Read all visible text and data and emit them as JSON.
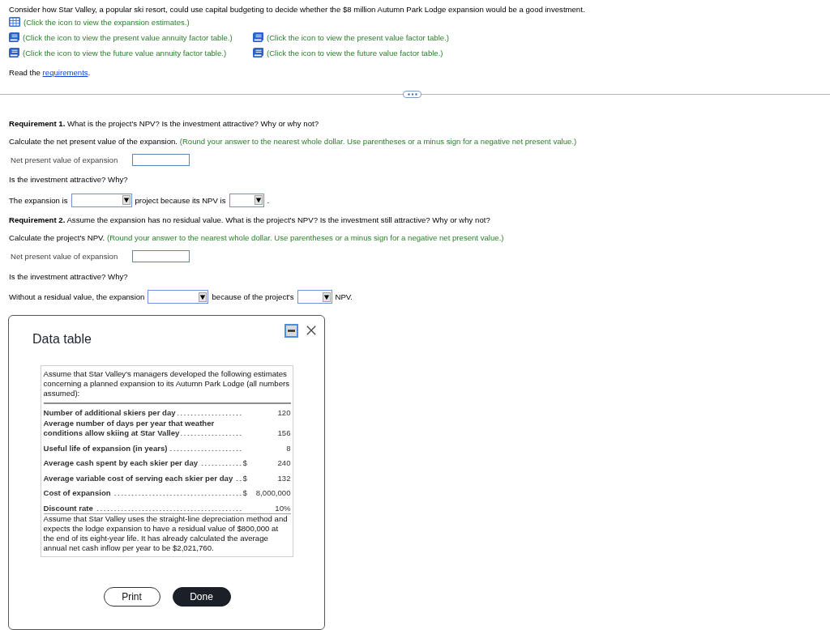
{
  "intro": "Consider how Star Valley, a popular ski resort, could use capital budgeting to decide whether the $8 million Autumn Park Lodge expansion would be a good investment.",
  "resources": [
    {
      "kind": "table",
      "text": "(Click the icon to view the expansion estimates.)"
    },
    {
      "kind": "book",
      "text": "(Click the icon to view the present value annuity factor table.)"
    },
    {
      "kind": "book",
      "text": "(Click the icon to view the present value factor table.)"
    },
    {
      "kind": "book",
      "text": "(Click the icon to view the future value annuity factor table.)"
    },
    {
      "kind": "book",
      "text": "(Click the icon to view the future value factor table.)"
    }
  ],
  "read_line": {
    "before": "Read the",
    "link": "requirements",
    "after": "."
  },
  "requirements": [
    {
      "question": "**Requirement 1.** What is the project's NPV? Is the investment attractive? Why or why not?",
      "instruction": "Calculate the net present value of the expansion.",
      "hint": "(Round your answer to the nearest whole dollar. Use parentheses or a minus sign for a negative net present value.)",
      "field_label": "Net present value of expansion",
      "followup": "Is the investment attractive? Why?",
      "sentence": [
        {
          "kind": "text",
          "text": "The expansion is"
        },
        {
          "kind": "select"
        },
        {
          "kind": "text",
          "text": "project because its NPV is"
        },
        {
          "kind": "select"
        },
        {
          "kind": "text",
          "text": "."
        }
      ]
    },
    {
      "question": "**Requirement 2.** Assume the expansion has no residual value. What is the project's NPV? Is the investment still attractive? Why or why not?",
      "instruction": "Calculate the project's NPV.",
      "hint": "(Round your answer to the nearest whole dollar. Use parentheses or a minus sign for a negative net present value.)",
      "field_label": "Net present value of expansion",
      "followup": "Is the investment attractive? Why?",
      "sentence": [
        {
          "kind": "text",
          "text": "Without a residual value, the expansion"
        },
        {
          "kind": "select"
        },
        {
          "kind": "text",
          "text": "because of the project's"
        },
        {
          "kind": "select"
        },
        {
          "kind": "text",
          "text": "NPV."
        }
      ]
    }
  ],
  "data_table": {
    "title": "Data table",
    "intro": "Assume that Star Valley's managers developed the following estimates concerning a planned expansion to its Autumn Park Lodge (all numbers assumed):",
    "rows": [
      {
        "label": "Number of additional skiers per day",
        "value": "120"
      },
      {
        "label": "Average number of days per year that weather conditions allow skiing at Star Valley",
        "value": "156"
      },
      {
        "label": "Useful life of expansion (in years)",
        "value": "8"
      },
      {
        "label": "Average cash spent by each skier per day",
        "currency": "$",
        "value": "240"
      },
      {
        "label": "Average variable cost of serving each skier per day",
        "currency": "$",
        "value": "132"
      },
      {
        "label": "Cost of expansion",
        "currency": "$",
        "value": "8,000,000"
      },
      {
        "label": "Discount rate",
        "value": "10%"
      }
    ],
    "note": "Assume that Star Valley uses the straight-line depreciation method and expects the lodge expansion to have a residual value of $800,000 at the end of its eight-year life. It has already calculated the average annual net cash inflow per year to be $2,021,760.",
    "buttons": [
      {
        "kind": "print",
        "label": "Print"
      },
      {
        "kind": "done",
        "label": "Done"
      }
    ]
  }
}
